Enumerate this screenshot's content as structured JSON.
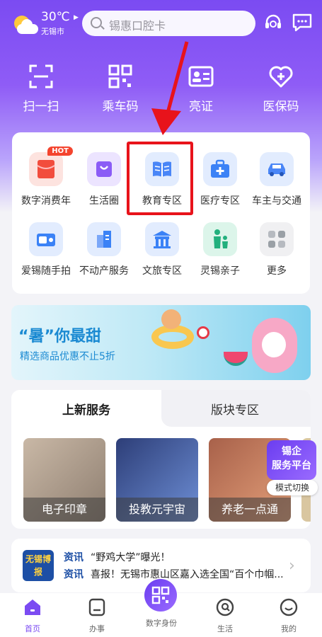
{
  "weather": {
    "temp": "30℃",
    "city": "无锡市"
  },
  "search": {
    "placeholder": "锡惠口腔卡"
  },
  "quick_actions": [
    "扫一扫",
    "乘车码",
    "亮证",
    "医保码"
  ],
  "services": [
    {
      "label": "数字消费年",
      "badge": "HOT",
      "icon": "red-envelope-icon",
      "color": "#f24d3d"
    },
    {
      "label": "生活圈",
      "icon": "shopping-bag-icon",
      "color": "#8b5cf6"
    },
    {
      "label": "教育专区",
      "icon": "book-icon",
      "color": "#4a86f7"
    },
    {
      "label": "医疗专区",
      "icon": "medical-kit-icon",
      "color": "#3b82f6"
    },
    {
      "label": "车主与交通",
      "icon": "car-icon",
      "color": "#4a86f7"
    },
    {
      "label": "爱锡随手拍",
      "icon": "camera-icon",
      "color": "#3b82f6"
    },
    {
      "label": "不动产服务",
      "icon": "building-icon",
      "color": "#3b82f6"
    },
    {
      "label": "文旅专区",
      "icon": "temple-icon",
      "color": "#3b82f6"
    },
    {
      "label": "灵锡亲子",
      "icon": "family-icon",
      "color": "#22b07d"
    },
    {
      "label": "更多",
      "icon": "grid-icon",
      "color": "#9aa0a6"
    }
  ],
  "banner": {
    "title": "“暑”你最甜",
    "subtitle": "精选商品优惠不止5折"
  },
  "tabs": {
    "active": "上新服务",
    "other": "版块专区"
  },
  "tiles": [
    "电子印章",
    "投教元宇宙",
    "养老一点通"
  ],
  "float_badge": {
    "line1": "锡企",
    "line2": "服务平台",
    "switch": "模式切换"
  },
  "news": {
    "logo": "无锡博报",
    "tag": "资讯",
    "items": [
      "“野鸡大学”曝光！",
      "喜报！无锡市惠山区嘉入选全国“百个巾帼..."
    ]
  },
  "bottom_nav": [
    "首页",
    "办事",
    "数字身份",
    "生活",
    "我的"
  ],
  "colors": {
    "brand": "#7b4bf2",
    "highlight": "#e8131b"
  }
}
